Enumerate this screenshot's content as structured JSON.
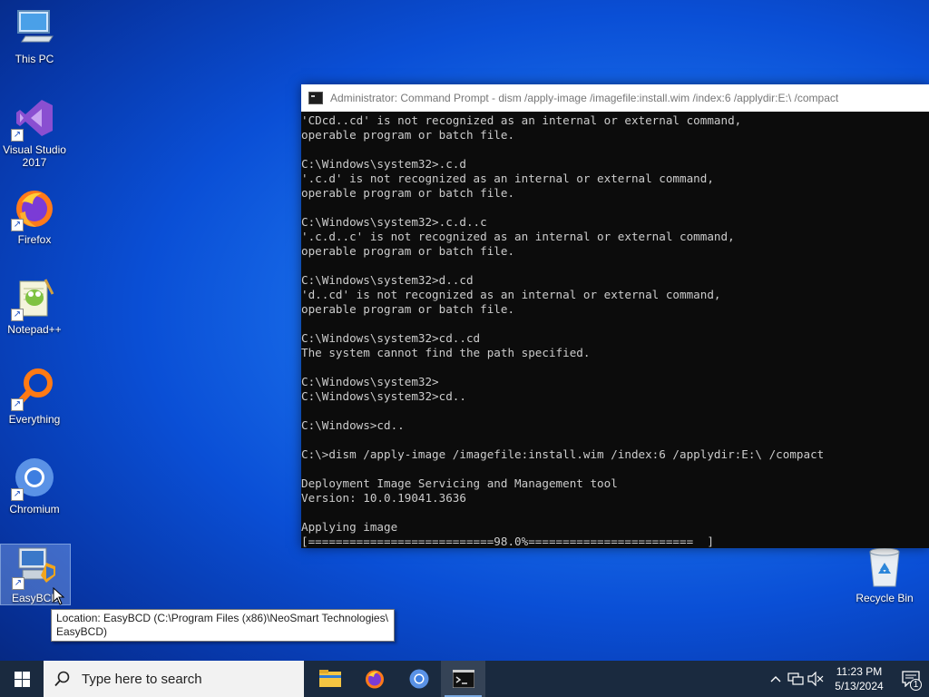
{
  "desktop": {
    "icons": [
      {
        "label": "This PC",
        "icon": "computer-icon"
      },
      {
        "label": "Visual Studio 2017",
        "icon": "visual-studio-icon"
      },
      {
        "label": "Firefox",
        "icon": "firefox-icon"
      },
      {
        "label": "Notepad++",
        "icon": "notepadpp-icon"
      },
      {
        "label": "Everything",
        "icon": "everything-search-icon"
      },
      {
        "label": "Chromium",
        "icon": "chromium-icon"
      },
      {
        "label": "EasyBCD",
        "icon": "easybcd-icon"
      },
      {
        "label": "Recycle Bin",
        "icon": "recycle-bin-icon"
      }
    ]
  },
  "cmd": {
    "title": "Administrator: Command Prompt - dism  /apply-image /imagefile:install.wim /index:6 /applydir:E:\\ /compact",
    "lines": [
      "'CDcd..cd' is not recognized as an internal or external command,",
      "operable program or batch file.",
      "",
      "C:\\Windows\\system32>.c.d",
      "'.c.d' is not recognized as an internal or external command,",
      "operable program or batch file.",
      "",
      "C:\\Windows\\system32>.c.d..c",
      "'.c.d..c' is not recognized as an internal or external command,",
      "operable program or batch file.",
      "",
      "C:\\Windows\\system32>d..cd",
      "'d..cd' is not recognized as an internal or external command,",
      "operable program or batch file.",
      "",
      "C:\\Windows\\system32>cd..cd",
      "The system cannot find the path specified.",
      "",
      "C:\\Windows\\system32>",
      "C:\\Windows\\system32>cd..",
      "",
      "C:\\Windows>cd..",
      "",
      "C:\\>dism /apply-image /imagefile:install.wim /index:6 /applydir:E:\\ /compact",
      "",
      "Deployment Image Servicing and Management tool",
      "Version: 10.0.19041.3636",
      "",
      "Applying image",
      "[===========================98.0%========================  ]"
    ],
    "progress_percent": 98.0
  },
  "tooltip": {
    "line1": "Location: EasyBCD (C:\\Program Files (x86)\\NeoSmart Technologies\\",
    "line2": "EasyBCD)"
  },
  "taskbar": {
    "search_placeholder": "Type here to search",
    "apps": [
      {
        "name": "File Explorer",
        "icon": "file-explorer-icon"
      },
      {
        "name": "Firefox",
        "icon": "firefox-icon"
      },
      {
        "name": "Chromium",
        "icon": "chromium-icon"
      },
      {
        "name": "Command Prompt",
        "icon": "command-prompt-icon",
        "active": true
      }
    ],
    "clock": {
      "time": "11:23 PM",
      "date": "5/13/2024"
    },
    "notification_count": "1"
  },
  "colors": {
    "console_bg": "#0c0c0c",
    "console_text": "#cccccc",
    "taskbar_bg": "#1a2a3f",
    "desktop_accent": "#1d76f0"
  }
}
